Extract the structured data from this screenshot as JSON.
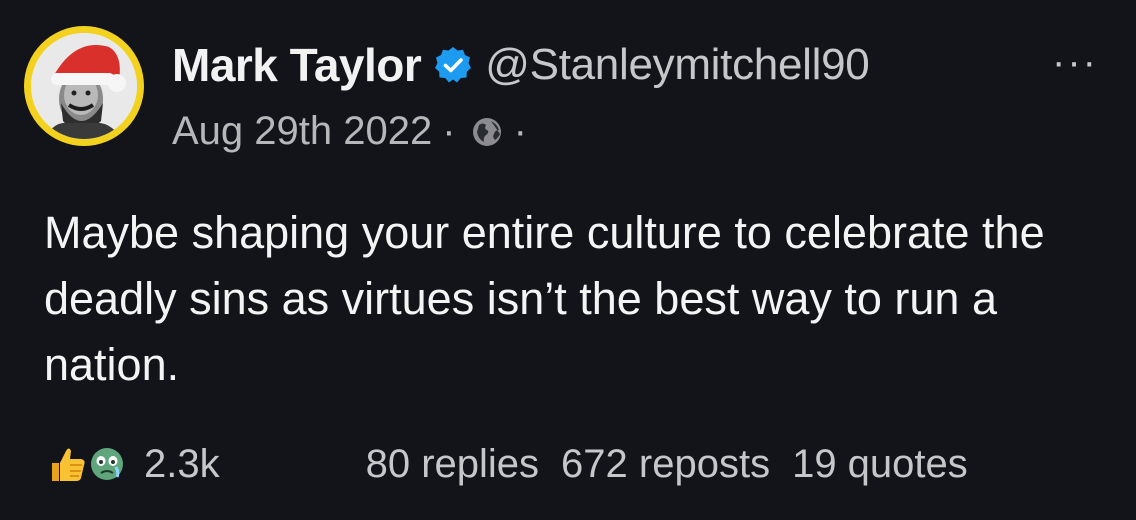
{
  "author": {
    "display_name": "Mark Taylor",
    "handle": "@Stanleymitchell90",
    "verified": true
  },
  "meta": {
    "date": "Aug 29th 2022",
    "separator": "·"
  },
  "post": {
    "text": "Maybe shaping your entire culture to celebrate the deadly sins as virtues isn’t the best way to run a nation."
  },
  "stats": {
    "likes": "2.3k",
    "replies": "80 replies",
    "reposts": "672 reposts",
    "quotes": "19 quotes"
  },
  "menu": {
    "more_label": "···"
  },
  "icons": {
    "verified": "verified-badge-icon",
    "visibility": "globe-icon",
    "reaction_1": "thumbs-up-icon",
    "reaction_2": "crying-face-icon",
    "more": "more-options-icon"
  },
  "colors": {
    "background": "#12141a",
    "verified_blue": "#1d9bf0",
    "avatar_ring": "#f2d21e"
  }
}
